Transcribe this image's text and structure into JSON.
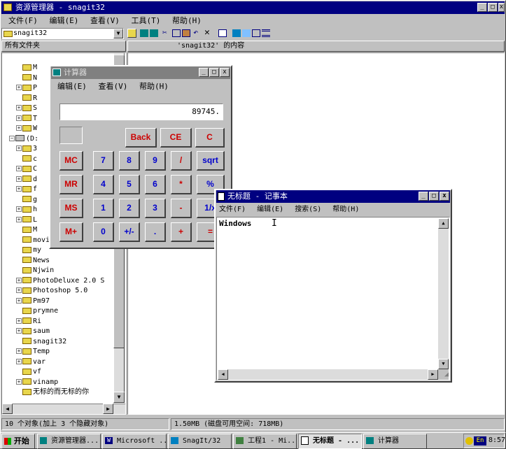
{
  "explorer": {
    "title": "资源管理器 - snagit32",
    "menu": [
      "文件(F)",
      "编辑(E)",
      "查看(V)",
      "工具(T)",
      "帮助(H)"
    ],
    "address": "snagit32",
    "tree_header": "所有文件夹",
    "content_header": "'snagit32' 的内容",
    "tree_items": [
      "M",
      "N",
      "P",
      "R",
      "S",
      "T",
      "W",
      "(D:",
      "3",
      "c",
      "C",
      "d",
      "f",
      "g",
      "h",
      "L",
      "M",
      "movie",
      "my",
      "News",
      "Njwin",
      "PhotoDeluxe 2.0 S",
      "Photoshop 5.0",
      "Pm97",
      "prymne",
      "Ri",
      "saum",
      "snagit32",
      "Temp",
      "var",
      "vf",
      "vinamp",
      "无标的而无标的你"
    ],
    "status_left": "10 个对象(加上 3 个隐藏对象)",
    "status_right": "1.50MB (磁盘可用空间: 718MB)"
  },
  "calculator": {
    "title": "计算器",
    "menu": [
      "编辑(E)",
      "查看(V)",
      "帮助(H)"
    ],
    "display": "89745.",
    "row0": [
      "Back",
      "CE",
      "C"
    ],
    "memory": [
      "MC",
      "MR",
      "MS",
      "M+"
    ],
    "row1": [
      "7",
      "8",
      "9",
      "/",
      "sqrt"
    ],
    "row2": [
      "4",
      "5",
      "6",
      "*",
      "%"
    ],
    "row3": [
      "1",
      "2",
      "3",
      "-",
      "1/x"
    ],
    "row4": [
      "0",
      "+/-",
      ".",
      "+",
      "="
    ]
  },
  "notepad": {
    "title": "无标题 - 记事本",
    "menu": [
      "文件(F)",
      "编辑(E)",
      "搜索(S)",
      "帮助(H)"
    ],
    "text": "Windows"
  },
  "taskbar": {
    "start": "开始",
    "buttons": [
      "资源管理器...",
      "Microsoft ...",
      "SnagIt/32",
      "工程1 - Mi...",
      "无标题 - ...",
      "计算器"
    ],
    "tray_lang": "En",
    "clock": "8:57"
  }
}
